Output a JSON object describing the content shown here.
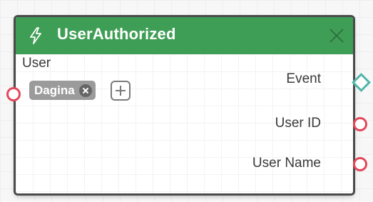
{
  "node": {
    "title": "UserAuthorized",
    "header_icon": "lightning-icon",
    "header_color": "#3f9e56",
    "close_icon": "close-icon"
  },
  "inputs": [
    {
      "label": "User",
      "port_color": "#e2485a",
      "chips": [
        {
          "label": "Dagina",
          "remove_icon": "close-circle-icon"
        }
      ],
      "add_icon": "plus-icon"
    }
  ],
  "outputs": [
    {
      "label": "Event",
      "port_shape": "diamond",
      "port_color": "#4fb5a7"
    },
    {
      "label": "User ID",
      "port_shape": "circle",
      "port_color": "#e2485a"
    },
    {
      "label": "User Name",
      "port_shape": "circle",
      "port_color": "#e2485a"
    }
  ]
}
